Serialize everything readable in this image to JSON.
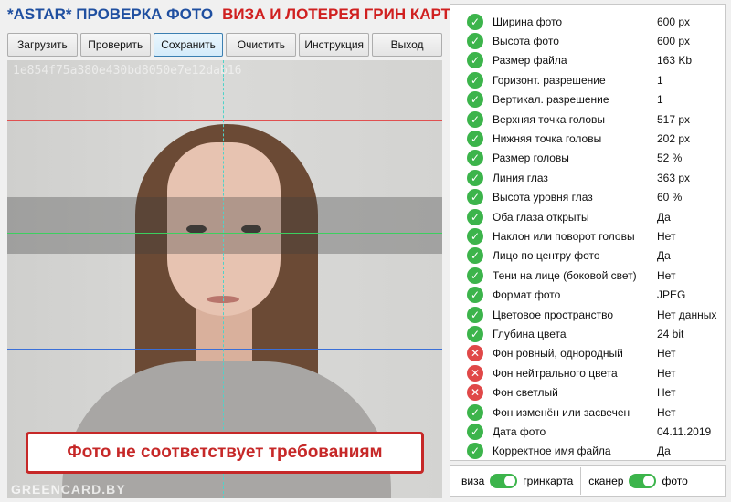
{
  "title": {
    "part1": "*ASTAR* ПРОВЕРКА ФОТО",
    "part2": "ВИЗА И ЛОТЕРЕЯ ГРИН КАРТА"
  },
  "toolbar": [
    "Загрузить",
    "Проверить",
    "Сохранить",
    "Очистить",
    "Инструкция",
    "Выход"
  ],
  "photo": {
    "hash": "1e854f75a380e430bd8050e7e12dab16",
    "watermark": "GREENCARD.BY",
    "status": "Фото не соответствует требованиям"
  },
  "colors": {
    "pass": "#3cb44b",
    "fail": "#e04848",
    "guide_red": "#e05050",
    "guide_green": "#3ccf5f",
    "guide_blue": "#3a6fd8"
  },
  "checks": [
    {
      "label": "Ширина фото",
      "value": "600 px",
      "status": "ok"
    },
    {
      "label": "Высота фото",
      "value": "600 px",
      "status": "ok"
    },
    {
      "label": "Размер файла",
      "value": "163 Kb",
      "status": "ok"
    },
    {
      "label": "Горизонт. разрешение",
      "value": "1",
      "status": "ok"
    },
    {
      "label": "Вертикал. разрешение",
      "value": "1",
      "status": "ok"
    },
    {
      "label": "Верхняя точка головы",
      "value": "517 px",
      "status": "ok"
    },
    {
      "label": "Нижняя точка головы",
      "value": "202 px",
      "status": "ok"
    },
    {
      "label": "Размер головы",
      "value": "52 %",
      "status": "ok"
    },
    {
      "label": "Линия глаз",
      "value": "363 px",
      "status": "ok"
    },
    {
      "label": "Высота уровня глаз",
      "value": "60 %",
      "status": "ok"
    },
    {
      "label": "Оба глаза открыты",
      "value": "Да",
      "status": "ok"
    },
    {
      "label": "Наклон или поворот головы",
      "value": "Нет",
      "status": "ok"
    },
    {
      "label": "Лицо по центру фото",
      "value": "Да",
      "status": "ok"
    },
    {
      "label": "Тени на лице (боковой свет)",
      "value": "Нет",
      "status": "ok"
    },
    {
      "label": "Формат фото",
      "value": "JPEG",
      "status": "ok"
    },
    {
      "label": "Цветовое пространство",
      "value": "Нет данных",
      "status": "ok"
    },
    {
      "label": "Глубина цвета",
      "value": "24 bit",
      "status": "ok"
    },
    {
      "label": "Фон ровный, однородный",
      "value": "Нет",
      "status": "fail"
    },
    {
      "label": "Фон нейтрального цвета",
      "value": "Нет",
      "status": "fail"
    },
    {
      "label": "Фон светлый",
      "value": "Нет",
      "status": "fail"
    },
    {
      "label": "Фон изменён или засвечен",
      "value": "Нет",
      "status": "ok"
    },
    {
      "label": "Дата фото",
      "value": "04.11.2019",
      "status": "ok"
    },
    {
      "label": "Корректное имя файла",
      "value": "Да",
      "status": "ok"
    }
  ],
  "switches": {
    "left": {
      "off_label": "виза",
      "on_label": "гринкарта"
    },
    "right": {
      "off_label": "сканер",
      "on_label": "фото"
    }
  }
}
